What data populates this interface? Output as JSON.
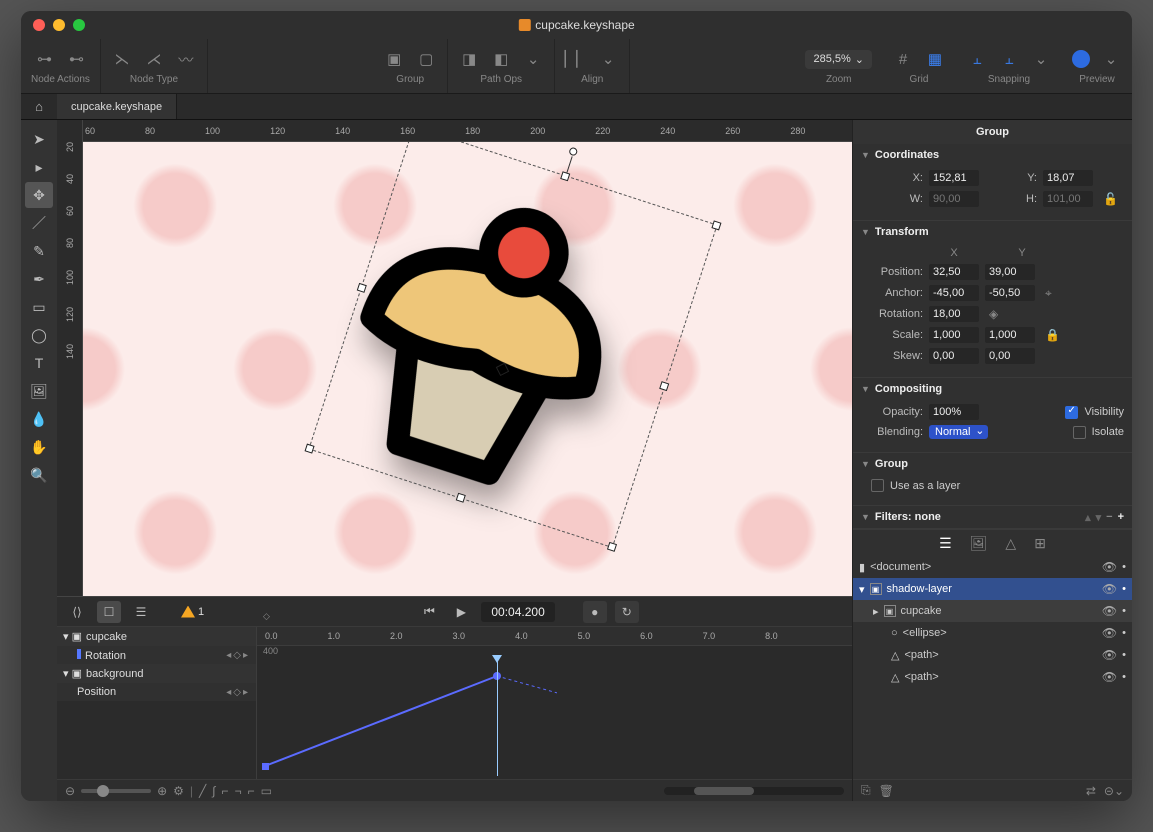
{
  "window_title": "cupcake.keyshape",
  "toolbar": {
    "node_actions": "Node Actions",
    "node_type": "Node Type",
    "group": "Group",
    "path_ops": "Path Ops",
    "align": "Align",
    "zoom_value": "285,5% ",
    "zoom": "Zoom",
    "grid": "Grid",
    "snapping": "Snapping",
    "preview": "Preview"
  },
  "tab": "cupcake.keyshape",
  "hruler": [
    "60",
    "80",
    "100",
    "120",
    "140",
    "160",
    "180",
    "200",
    "220",
    "240",
    "260",
    "280"
  ],
  "vruler": [
    "20",
    "40",
    "60",
    "80",
    "100",
    "120",
    "140"
  ],
  "timeline": {
    "warning_count": "1",
    "time": "00:04.200",
    "ruler": [
      "0.0",
      "1.0",
      "2.0",
      "3.0",
      "4.0",
      "5.0",
      "6.0",
      "7.0",
      "8.0"
    ],
    "subruler": "400",
    "tree": {
      "item1": "cupcake",
      "item1_prop": "Rotation",
      "item2": "background",
      "item2_prop": "Position"
    }
  },
  "inspector": {
    "title": "Group",
    "coords": {
      "hdr": "Coordinates",
      "x_lbl": "X:",
      "x": "152,81",
      "y_lbl": "Y:",
      "y": "18,07",
      "w_lbl": "W:",
      "w": "90,00",
      "h_lbl": "H:",
      "h": "101,00"
    },
    "transform": {
      "hdr": "Transform",
      "xy_x": "X",
      "xy_y": "Y",
      "pos_lbl": "Position:",
      "pos_x": "32,50",
      "pos_y": "39,00",
      "anc_lbl": "Anchor:",
      "anc_x": "-45,00",
      "anc_y": "-50,50",
      "rot_lbl": "Rotation:",
      "rot": "18,00",
      "scl_lbl": "Scale:",
      "scl_x": "1,000",
      "scl_y": "1,000",
      "skw_lbl": "Skew:",
      "skw_x": "0,00",
      "skw_y": "0,00"
    },
    "comp": {
      "hdr": "Compositing",
      "op_lbl": "Opacity:",
      "op": "100%",
      "vis": "Visibility",
      "bl_lbl": "Blending:",
      "bl": "Normal",
      "iso": "Isolate"
    },
    "group": {
      "hdr": "Group",
      "layer": "Use as a layer"
    },
    "filters": {
      "hdr": "Filters: none"
    }
  },
  "layers": {
    "doc": "<document>",
    "l1": "shadow-layer",
    "l2": "cupcake",
    "l3": "<ellipse>",
    "l4": "<path>",
    "l5": "<path>"
  }
}
